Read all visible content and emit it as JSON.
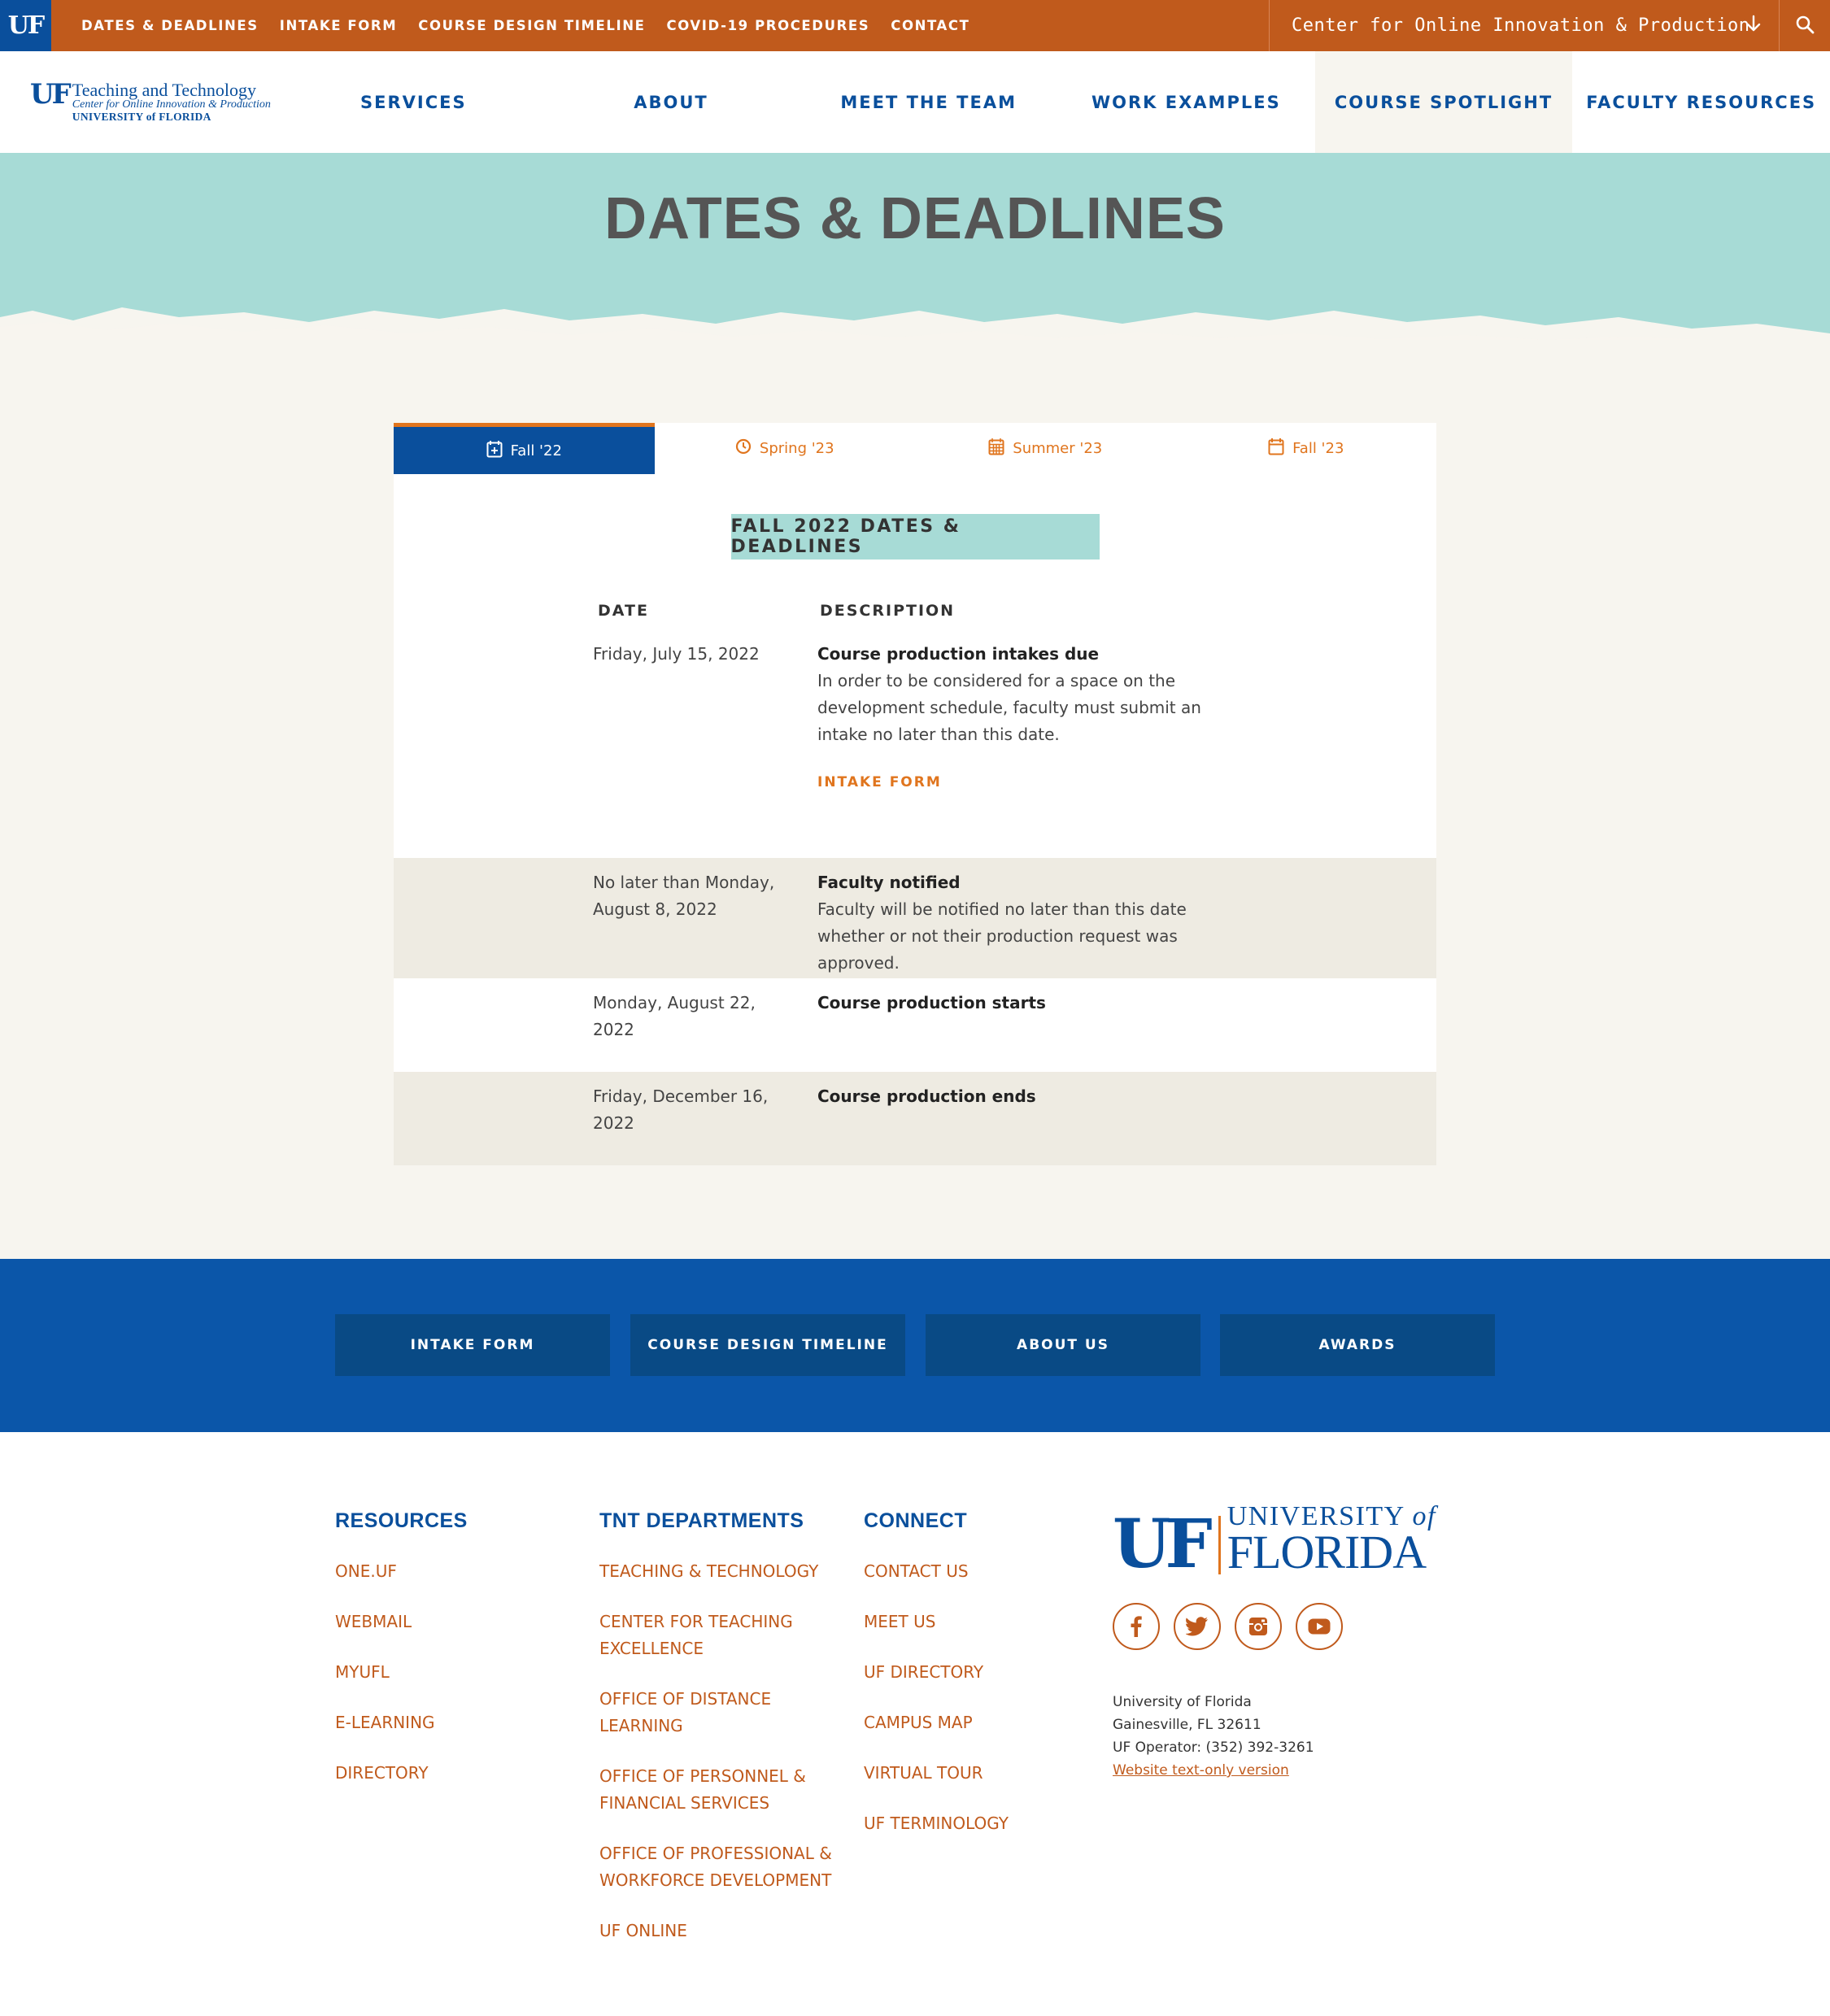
{
  "topbar": {
    "uf_mark": "UF",
    "links": [
      "DATES & DEADLINES",
      "INTAKE FORM",
      "COURSE DESIGN TIMELINE",
      "COVID-19 PROCEDURES",
      "CONTACT"
    ],
    "center_selector": "Center for Online Innovation & Production",
    "arrow_icon": "arrow-down-icon",
    "search_icon": "search-icon"
  },
  "brand": {
    "mark": "UF",
    "title": "Teaching and Technology",
    "subtitle": "Center for Online Innovation & Production",
    "university": "UNIVERSITY of FLORIDA"
  },
  "nav": {
    "items": [
      "SERVICES",
      "ABOUT",
      "MEET THE TEAM",
      "WORK EXAMPLES",
      "COURSE SPOTLIGHT",
      "FACULTY RESOURCES"
    ],
    "active": "COURSE SPOTLIGHT"
  },
  "hero": {
    "title": "DATES & DEADLINES"
  },
  "tabs": [
    {
      "label": "Fall '22",
      "icon": "calendar-plus-icon",
      "active": true
    },
    {
      "label": "Spring '23",
      "icon": "clock-icon",
      "active": false
    },
    {
      "label": "Summer '23",
      "icon": "calendar-grid-icon",
      "active": false
    },
    {
      "label": "Fall '23",
      "icon": "calendar-icon",
      "active": false
    }
  ],
  "deadlines": {
    "title": "FALL 2022 DATES & DEADLINES",
    "col_date": "DATE",
    "col_desc": "DESCRIPTION",
    "rows": [
      {
        "date": "Friday, July 15, 2022",
        "title": "Course production intakes due",
        "text": "In order to be considered for a space on the development schedule, faculty must submit an intake no later than this date.",
        "link": "INTAKE FORM"
      },
      {
        "date": "No later than Monday, August 8, 2022",
        "title": "Faculty notified",
        "text": "Faculty will be notified no later than this date whether or not their production request was approved."
      },
      {
        "date": "Monday, August 22, 2022",
        "title": "Course production starts"
      },
      {
        "date": "Friday, December 16, 2022",
        "title": "Course production ends"
      }
    ]
  },
  "quick_links": [
    "INTAKE FORM",
    "COURSE DESIGN TIMELINE",
    "ABOUT US",
    "AWARDS"
  ],
  "footer": {
    "resources": {
      "heading": "RESOURCES",
      "items": [
        "ONE.UF",
        "WEBMAIL",
        "MYUFL",
        "E-LEARNING",
        "DIRECTORY"
      ]
    },
    "departments": {
      "heading": "TNT DEPARTMENTS",
      "items": [
        "TEACHING & TECHNOLOGY",
        "CENTER FOR TEACHING EXCELLENCE",
        "OFFICE OF DISTANCE LEARNING",
        "OFFICE OF PERSONNEL & FINANCIAL SERVICES",
        "OFFICE OF PROFESSIONAL & WORKFORCE DEVELOPMENT",
        "UF ONLINE"
      ]
    },
    "connect": {
      "heading": "CONNECT",
      "items": [
        "CONTACT US",
        "MEET US",
        "UF DIRECTORY",
        "CAMPUS MAP",
        "VIRTUAL TOUR",
        "UF TERMINOLOGY"
      ]
    },
    "logo": {
      "mark": "UF",
      "line1": "UNIVERSITY",
      "line1_of": "of",
      "line2": "FLORIDA"
    },
    "social": [
      "facebook-icon",
      "twitter-icon",
      "instagram-icon",
      "youtube-icon"
    ],
    "address": {
      "line1": "University of Florida",
      "line2": "Gainesville, FL 32611",
      "line3": "UF Operator: (352) 392-3261",
      "text_only": "Website text-only version"
    }
  },
  "colors": {
    "uf_orange": "#c05a1c",
    "uf_blue": "#0a4f9c",
    "accent_orange": "#e0751e",
    "teal": "#a7dbd6",
    "cream": "#f7f5ef"
  }
}
